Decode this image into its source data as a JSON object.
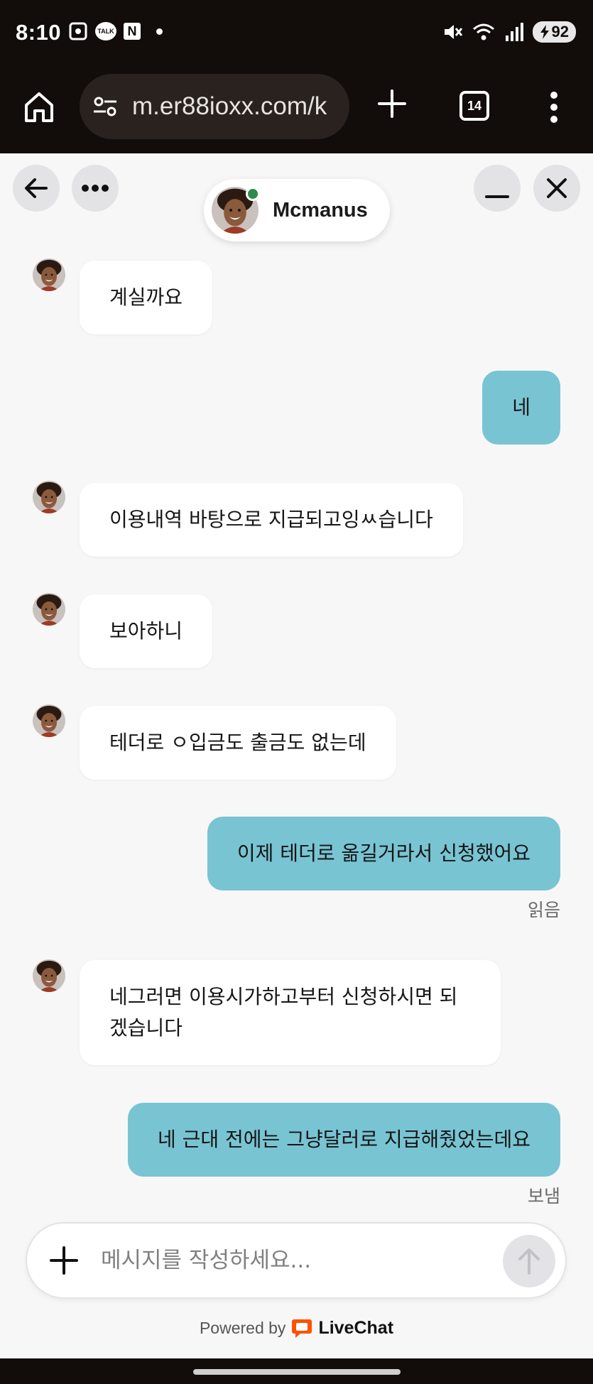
{
  "status_bar": {
    "time": "8:10",
    "talk_icon_label": "TALK",
    "n_icon_label": "N",
    "battery": "92",
    "icons": [
      "screenshot-icon",
      "talk-icon",
      "naver-icon",
      "dot-icon",
      "mute-icon",
      "wifi-icon",
      "signal-icon",
      "battery-icon"
    ]
  },
  "browser": {
    "url": "m.er88ioxx.com/k",
    "tab_count": "14"
  },
  "chat": {
    "agent_name": "Mcmanus",
    "agent_status_color": "#2e8b4b",
    "messages": [
      {
        "from": "agent",
        "text": "계실까요"
      },
      {
        "from": "me",
        "text": "네"
      },
      {
        "from": "agent",
        "text": "이용내역 바탕으로 지급되고잉ㅆ습니다"
      },
      {
        "from": "agent",
        "text": "보아하니"
      },
      {
        "from": "agent",
        "text": "테더로 ㅇ입금도 출금도 없는데"
      },
      {
        "from": "me",
        "text": "이제 테더로 옮길거라서 신청했어요",
        "status": "읽음"
      },
      {
        "from": "agent",
        "text": "네그러면 이용시가하고부터 신청하시면 되겠습니다"
      },
      {
        "from": "me",
        "text": "네 근대 전에는 그냥달러로 지급해줬었는데요",
        "status": "보냄"
      }
    ]
  },
  "composer": {
    "placeholder": "메시지를 작성하세요..."
  },
  "footer": {
    "powered_by": "Powered by",
    "brand": "LiveChat"
  },
  "colors": {
    "user_bubble": "#78c4d2",
    "agent_bubble": "#ffffff",
    "background": "#f7f7f8",
    "livechat_brand": "#ff5100"
  }
}
